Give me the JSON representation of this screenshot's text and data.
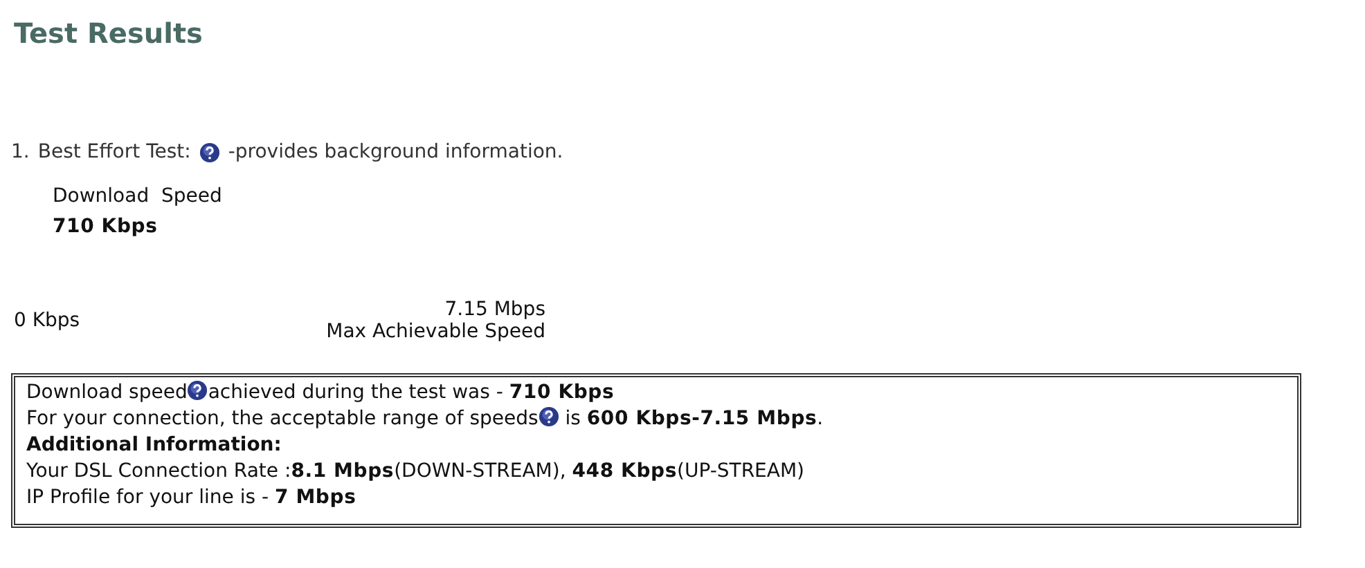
{
  "title": "Test Results",
  "test": {
    "number": "1.",
    "name": "Best Effort Test:",
    "description": "-provides background information."
  },
  "download": {
    "label": "Download  Speed",
    "value": "710 Kbps"
  },
  "range": {
    "min": "0 Kbps",
    "max": "7.15 Mbps",
    "max_label": "Max Achievable Speed"
  },
  "info": [
    {
      "kind": "help",
      "before": "Download speed",
      "after": "achieved during the test was - **710 Kbps**"
    },
    {
      "kind": "help",
      "before": "For your connection, the acceptable range of speeds",
      "after": " is **600 Kbps-7.15 Mbps**."
    },
    {
      "kind": "heading",
      "before": "Additional Information:"
    },
    {
      "kind": "text",
      "before": "Your DSL Connection Rate :**8.1 Mbps**(DOWN-STREAM), **448 Kbps**(UP-STREAM)"
    },
    {
      "kind": "text",
      "before": "IP Profile for your line is - **7 Mbps**"
    }
  ]
}
